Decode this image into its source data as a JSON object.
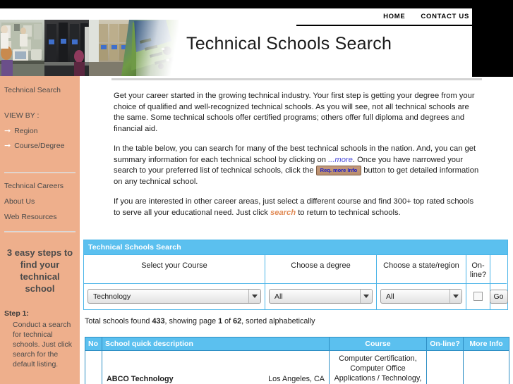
{
  "header": {
    "title": "Technical Schools Search",
    "nav": [
      {
        "label": "HOME",
        "name": "nav-home"
      },
      {
        "label": "CONTACT US",
        "name": "nav-contact-us"
      }
    ]
  },
  "sidebar": {
    "top_link": "Technical Search",
    "view_by_label": "VIEW BY :",
    "view_by_items": [
      {
        "label": "Region"
      },
      {
        "label": "Course/Degree"
      }
    ],
    "secondary_items": [
      {
        "label": "Technical Careers"
      },
      {
        "label": "About Us"
      },
      {
        "label": "Web Resources"
      }
    ],
    "promo_title": "3 easy steps to find your technical school",
    "step_title": "Step 1:",
    "step_body": "Conduct a search for technical schools. Just click search for the default listing.",
    "background_color": "#eeaf8c"
  },
  "intro": {
    "p1": "Get your career started in the growing technical industry. Your first step is getting your degree from your choice of qualified and well-recognized technical schools. As you will see, not all technical schools are the same. Some technical schools offer certified programs; others offer full diploma and degrees and financial aid.",
    "p2_a": "In the table below, you can search for many of the best technical schools in the nation. And, you can get summary information for each technical school by clicking on ",
    "p2_more": "...more",
    "p2_b": ". Once you have narrowed your search to your preferred list of technical schools, click the ",
    "p2_button": "Req. more Info",
    "p2_c": " button to get detailed information on any technical school.",
    "p3_a": "If you are interested in other career areas, just select a different course and find 300+ top rated schools to serve all your educational need. Just click ",
    "p3_search": "search",
    "p3_b": " to return to technical schools."
  },
  "search_panel": {
    "title": "Technical Schools Search",
    "columns": [
      {
        "header": "Select your Course"
      },
      {
        "header": "Choose a degree"
      },
      {
        "header": "Choose a state/region"
      },
      {
        "header": "On-line?"
      }
    ],
    "course_value": "Technology",
    "degree_value": "All",
    "state_value": "All",
    "online_checked": false,
    "go_label": "Go",
    "accent_color": "#5bc0ef"
  },
  "results": {
    "summary_prefix": "Total schools found ",
    "total_found": "433",
    "summary_mid": ", showing page ",
    "page": "1",
    "summary_of": " of ",
    "total_pages": "62",
    "summary_suffix": ", sorted alphabetically",
    "columns": [
      "No",
      "School quick description",
      "Course",
      "On-line?",
      "More Info"
    ],
    "rows": [
      {
        "no": "",
        "school": "ABCO Technology",
        "city": "Los Angeles, CA",
        "course": "Computer Certification, Computer Office Applications / Technology,",
        "online": "",
        "more_info": ""
      }
    ]
  }
}
